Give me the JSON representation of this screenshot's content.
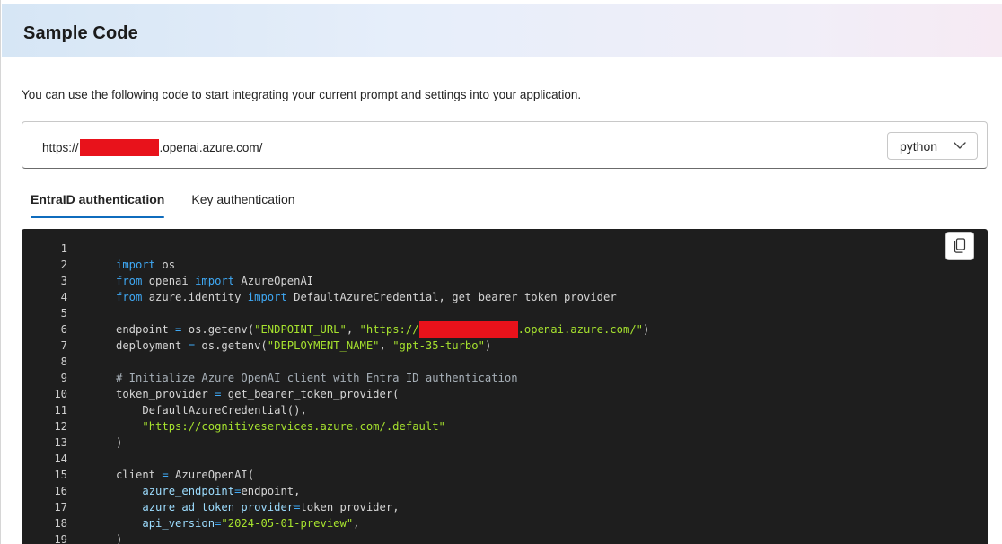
{
  "header": {
    "title": "Sample Code"
  },
  "description": "You can use the following code to start integrating your current prompt and settings into your application.",
  "endpoint": {
    "prefix": "https://",
    "suffix": ".openai.azure.com/"
  },
  "language_select": {
    "selected": "python"
  },
  "tabs": [
    {
      "label": "EntraID authentication",
      "active": true
    },
    {
      "label": "Key authentication",
      "active": false
    }
  ],
  "code": {
    "line_numbers": [
      "1",
      "2",
      "3",
      "4",
      "5",
      "6",
      "7",
      "8",
      "9",
      "10",
      "11",
      "12",
      "13",
      "14",
      "15",
      "16",
      "17",
      "18",
      "19"
    ],
    "l2": {
      "kw": "import",
      "rest": " os"
    },
    "l3": {
      "kw1": "from",
      "mid": " openai ",
      "kw2": "import",
      "rest": " AzureOpenAI"
    },
    "l4": {
      "kw1": "from",
      "mid": " azure.identity ",
      "kw2": "import",
      "rest": " DefaultAzureCredential, get_bearer_token_provider"
    },
    "l6": {
      "a": "endpoint ",
      "op": "=",
      "b": " os.getenv(",
      "s1": "\"ENDPOINT_URL\"",
      "c": ", ",
      "s2": "\"https://",
      "s3": ".openai.azure.com/\"",
      "d": ")"
    },
    "l7": {
      "a": "deployment ",
      "op": "=",
      "b": " os.getenv(",
      "s1": "\"DEPLOYMENT_NAME\"",
      "c": ", ",
      "s2": "\"gpt-35-turbo\"",
      "d": ")"
    },
    "l9": {
      "cmt": "# Initialize Azure OpenAI client with Entra ID authentication"
    },
    "l10": {
      "a": "token_provider ",
      "op": "=",
      "b": " get_bearer_token_provider("
    },
    "l11": {
      "a": "    DefaultAzureCredential(),"
    },
    "l12": {
      "s": "\"https://cognitiveservices.azure.com/.default\""
    },
    "l13": {
      "a": ")"
    },
    "l15": {
      "a": "client ",
      "op": "=",
      "b": " AzureOpenAI("
    },
    "l16": {
      "p": "azure_endpoint",
      "op": "=",
      "b": "endpoint,"
    },
    "l17": {
      "p": "azure_ad_token_provider",
      "op": "=",
      "b": "token_provider,"
    },
    "l18": {
      "p": "api_version",
      "op": "=",
      "s": "\"2024-05-01-preview\"",
      "b": ","
    },
    "l19": {
      "a": ")"
    }
  }
}
